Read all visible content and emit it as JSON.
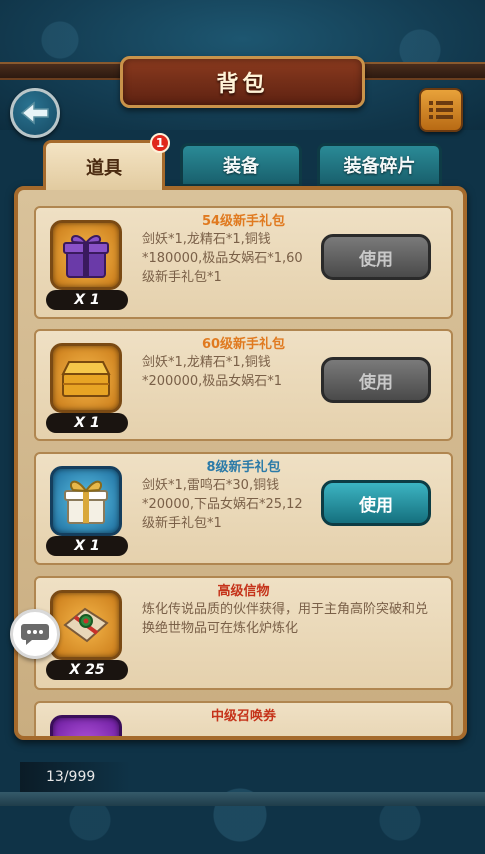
{
  "header": {
    "title": "背包"
  },
  "tabs": [
    {
      "label": "道具",
      "active": true,
      "badge": "1"
    },
    {
      "label": "装备",
      "active": false
    },
    {
      "label": "装备碎片",
      "active": false
    }
  ],
  "items": [
    {
      "title": "54级新手礼包",
      "description": "剑妖*1,龙精石*1,铜钱*180000,极品女娲石*1,60级新手礼包*1",
      "quantity": "X 1",
      "button": "使用",
      "button_enabled": false,
      "icon": "purple-gift-box-icon"
    },
    {
      "title": "60级新手礼包",
      "description": "剑妖*1,龙精石*1,铜钱*200000,极品女娲石*1",
      "quantity": "X 1",
      "button": "使用",
      "button_enabled": false,
      "icon": "golden-chest-icon"
    },
    {
      "title": "8级新手礼包",
      "description": "剑妖*1,雷鸣石*30,铜钱*20000,下品女娲石*25,12级新手礼包*1",
      "quantity": "X 1",
      "button": "使用",
      "button_enabled": true,
      "icon": "gift-box-bow-icon"
    },
    {
      "title": "高级信物",
      "description": "炼化传说品质的伙伴获得，用于主角高阶突破和兑换绝世物品可在炼化炉炼化",
      "quantity": "X 25",
      "icon": "wrapped-token-icon"
    },
    {
      "title": "中级召唤券",
      "icon": "summon-ticket-icon"
    }
  ],
  "footer": {
    "capacity": "13/999"
  },
  "colors": {
    "accent_orange": "#e07a20",
    "accent_blue": "#2a7aa8",
    "tab_teal": "#2a8a96",
    "panel_bg": "#d9c29a"
  }
}
